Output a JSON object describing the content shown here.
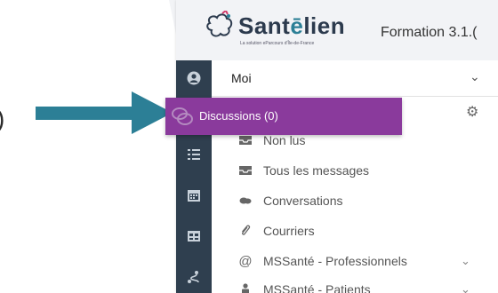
{
  "brand": {
    "name_prefix": "Sant",
    "name_accent": "ē",
    "name_suffix": "lien",
    "tagline": "La solution eParcours d'Île-de-France",
    "text_color": "#2c3a4d",
    "accent_color": "#2c7f96"
  },
  "version_label": "Formation 3.1.(",
  "annotation": {
    "paren": ")",
    "arrow_color": "#2c7f96"
  },
  "user_select": {
    "value": "Moi"
  },
  "popup": {
    "label": "Discussions (0)",
    "color": "#8a3a9c"
  },
  "menu": [
    {
      "label": "Non lus",
      "icon": "inbox-icon"
    },
    {
      "label": "Tous les messages",
      "icon": "inbox-icon"
    },
    {
      "label": "Conversations",
      "icon": "chat-icon"
    },
    {
      "label": "Courriers",
      "icon": "paperclip-icon"
    },
    {
      "label": "MSSanté - Professionnels",
      "icon": "at-icon",
      "has_chevron": true
    },
    {
      "label": "MSSanté - Patients",
      "icon": "person-icon",
      "has_chevron": true
    }
  ],
  "sidebar_icons": [
    "user-icon",
    "chat-icon",
    "list-icon",
    "calendar-icon",
    "table-icon",
    "route-icon"
  ],
  "colors": {
    "sidebar": "#2f3f4f",
    "header": "#f2f3f6"
  }
}
